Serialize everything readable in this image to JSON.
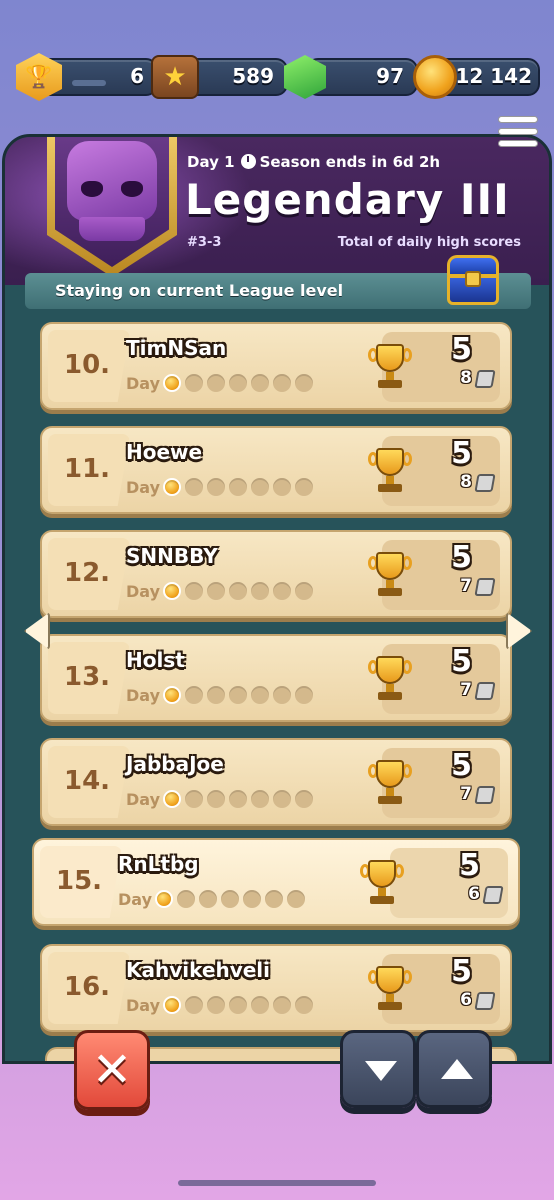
{
  "currencies": [
    {
      "name": "trophies",
      "value": "6"
    },
    {
      "name": "stars",
      "value": "589"
    },
    {
      "name": "gems",
      "value": "97"
    },
    {
      "name": "coins",
      "value": "12 142"
    }
  ],
  "header": {
    "day_label": "Day 1",
    "season_label": "Season ends in 6d 2h",
    "league_title": "Legendary III",
    "group_label": "#3-3",
    "total_label": "Total of daily high scores"
  },
  "status": {
    "text": "Staying on current League level"
  },
  "rows": [
    {
      "rank": "10.",
      "name": "TimNSan",
      "day_label": "Day",
      "score": "5",
      "sub": "8"
    },
    {
      "rank": "11.",
      "name": "Hoewe",
      "day_label": "Day",
      "score": "5",
      "sub": "8"
    },
    {
      "rank": "12.",
      "name": "SNNBBY",
      "day_label": "Day",
      "score": "5",
      "sub": "7"
    },
    {
      "rank": "13.",
      "name": "Holst",
      "day_label": "Day",
      "score": "5",
      "sub": "7"
    },
    {
      "rank": "14.",
      "name": "JabbaJoe",
      "day_label": "Day",
      "score": "5",
      "sub": "7"
    },
    {
      "rank": "15.",
      "name": "RnLtbg",
      "day_label": "Day",
      "score": "5",
      "sub": "6"
    },
    {
      "rank": "16.",
      "name": "Kahvikehveli",
      "day_label": "Day",
      "score": "5",
      "sub": "6"
    }
  ],
  "buttons": {
    "close": "✕"
  },
  "colors": {
    "panel": "#27535a",
    "header": "#3a1f4f",
    "row": "#f7e7c4",
    "close_button": "#e2493a",
    "nav_button": "#3b455b"
  },
  "icons": [
    "trophy-icon",
    "star-icon",
    "gem-icon",
    "coin-icon",
    "skull-emblem-icon",
    "clock-icon",
    "menu-icon",
    "chest-icon",
    "tower-icon"
  ]
}
